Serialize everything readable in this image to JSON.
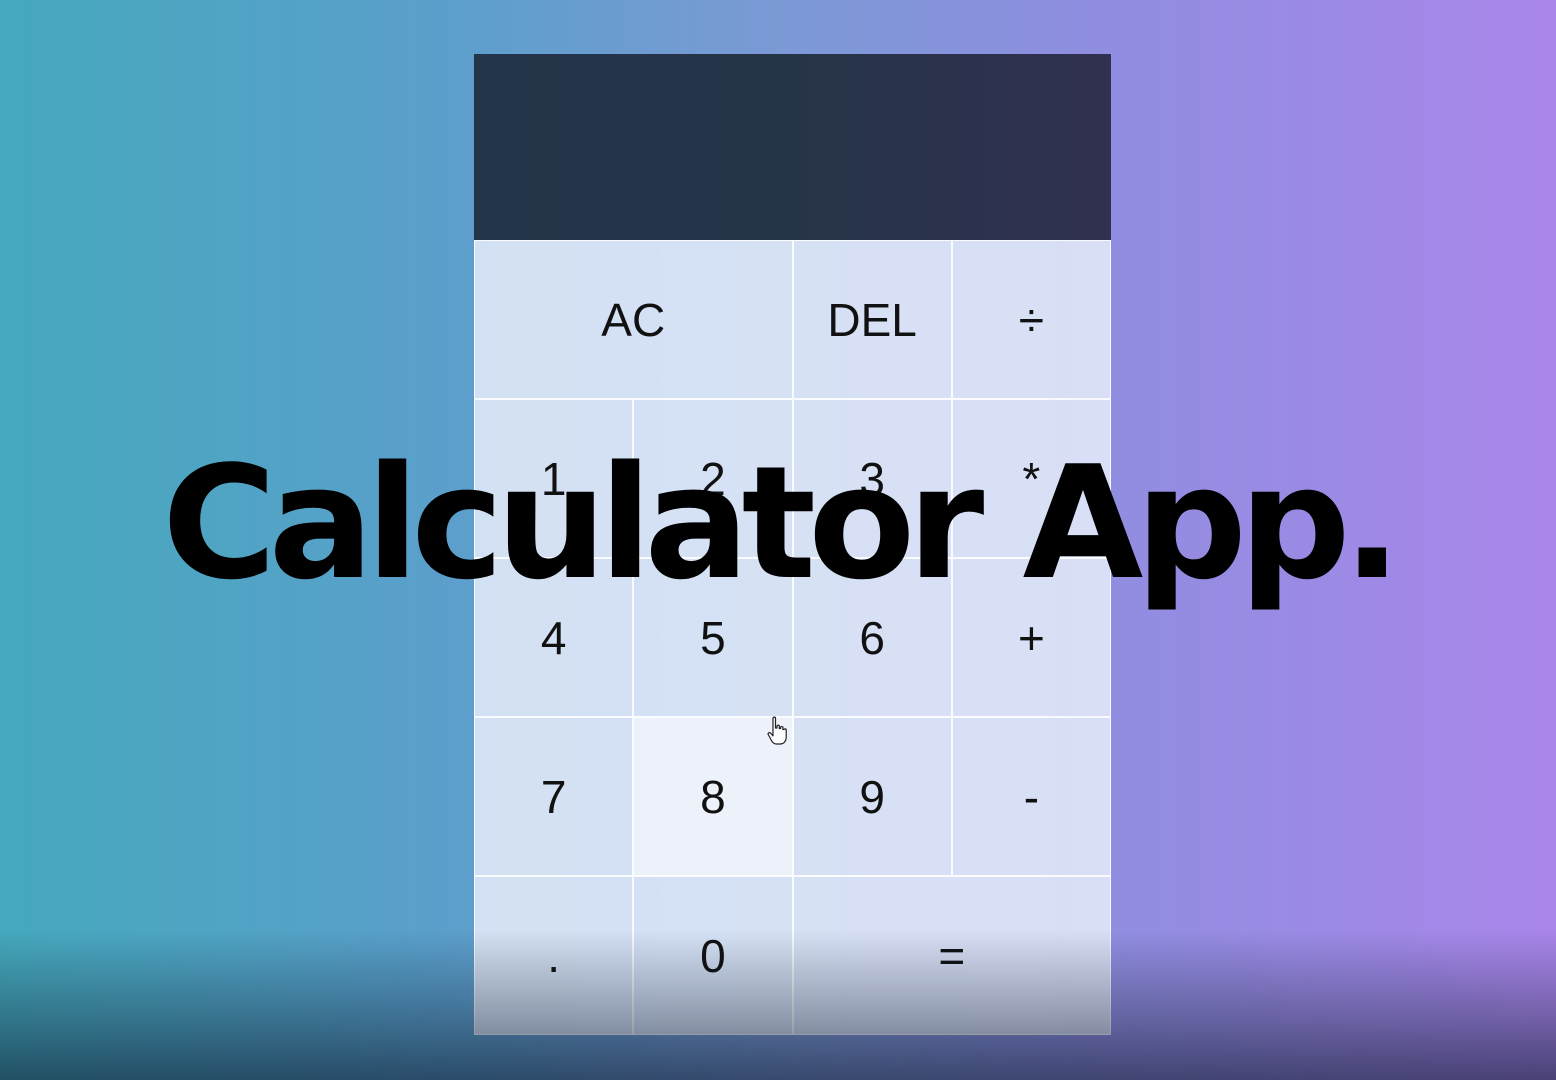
{
  "calculator": {
    "display": {
      "previous_operand": "",
      "current_operand": ""
    },
    "keys": {
      "all_clear": "AC",
      "delete": "DEL",
      "divide": "÷",
      "one": "1",
      "two": "2",
      "three": "3",
      "multiply": "*",
      "four": "4",
      "five": "5",
      "six": "6",
      "add": "+",
      "seven": "7",
      "eight": "8",
      "nine": "9",
      "subtract": "-",
      "decimal": ".",
      "zero": "0",
      "equals": "="
    }
  },
  "overlay": {
    "title": "Calculator App."
  },
  "cursor": {
    "icon": "hand-pointer-icon"
  },
  "colors": {
    "display_background": "#263449",
    "key_background": "#e2eaf8",
    "background_left": "#45a9bd",
    "background_right": "#a986ea"
  }
}
